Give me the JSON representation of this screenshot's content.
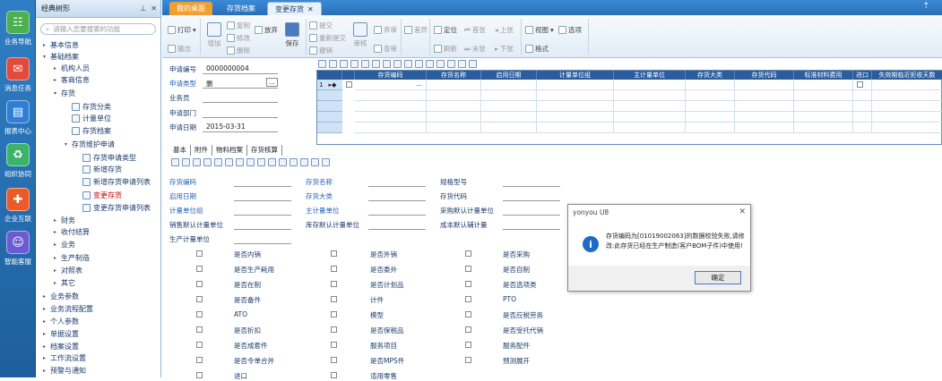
{
  "sidebar": {
    "items": [
      {
        "label": "业务导航"
      },
      {
        "label": "消息任务"
      },
      {
        "label": "报表中心"
      },
      {
        "label": "组织协同"
      },
      {
        "label": "企业互联"
      },
      {
        "label": "智能客服"
      }
    ]
  },
  "nav": {
    "title": "经典树形",
    "search_placeholder": "请输入您要搜索的功能",
    "items": [
      {
        "label": "基本信息",
        "arrow": "▸"
      },
      {
        "label": "基础档案",
        "arrow": "▾"
      },
      {
        "label": "机构人员",
        "arrow": "▸"
      },
      {
        "label": "客商信息",
        "arrow": "▸"
      },
      {
        "label": "存货",
        "arrow": "▾"
      },
      {
        "label": "存货分类"
      },
      {
        "label": "计量单位"
      },
      {
        "label": "存货档案"
      },
      {
        "label": "存货维护申请",
        "arrow": "▾"
      },
      {
        "label": "存货申请类型"
      },
      {
        "label": "新增存货"
      },
      {
        "label": "新增存货申请列表"
      },
      {
        "label": "变更存货"
      },
      {
        "label": "变更存货申请列表"
      },
      {
        "label": "财务",
        "arrow": "▸"
      },
      {
        "label": "收付结算",
        "arrow": "▸"
      },
      {
        "label": "业务",
        "arrow": "▸"
      },
      {
        "label": "生产制造",
        "arrow": "▸"
      },
      {
        "label": "对照表",
        "arrow": "▸"
      },
      {
        "label": "其它",
        "arrow": "▸"
      },
      {
        "label": "业务参数",
        "arrow": "▸"
      },
      {
        "label": "业务流程配置",
        "arrow": "▸"
      },
      {
        "label": "个人参数",
        "arrow": "▸"
      },
      {
        "label": "单据设置",
        "arrow": "▸"
      },
      {
        "label": "档案设置",
        "arrow": "▸"
      },
      {
        "label": "工作流设置",
        "arrow": "▸"
      },
      {
        "label": "预警与通知",
        "arrow": "▸"
      }
    ]
  },
  "tabs": [
    {
      "label": "我的桌面"
    },
    {
      "label": "存货档案"
    },
    {
      "label": "变更存货"
    }
  ],
  "toolbar": {
    "print": "打印",
    "output": "输出",
    "add": "增加",
    "copy": "复制",
    "modify": "修改",
    "delete": "删除",
    "abandon": "放弃",
    "save": "保存",
    "submit": "提交",
    "resubmit": "重新提交",
    "revoke": "撤销",
    "approve": "审核",
    "reject": "弃审",
    "check": "查审",
    "diff": "差异",
    "locate": "定位",
    "refresh": "刷新",
    "first": "首张",
    "prev": "上张",
    "last": "末张",
    "next": "下张",
    "view": "视图",
    "format": "格式",
    "options": "选项"
  },
  "header": {
    "no_label": "申请编号",
    "no_value": "0000000004",
    "type_label": "申请类型",
    "type_value": "删",
    "person_label": "业务员",
    "dept_label": "申请部门",
    "date_label": "申请日期",
    "date_value": "2015-03-31"
  },
  "grid": {
    "columns": [
      "存货编码",
      "存货名称",
      "启用日期",
      "计量单位组",
      "主计量单位",
      "存货大类",
      "存货代码",
      "标准材料费用",
      "进口",
      "失效期临近拒收天数"
    ],
    "row_no": "1"
  },
  "subtabs": [
    "基本",
    "附件",
    "物料档案",
    "存货核算"
  ],
  "fields": {
    "c1": [
      "存货编码",
      "启用日期",
      "计量单位组",
      "销售默认计量单位",
      "生产计量单位"
    ],
    "c2": [
      "存货名称",
      "存货大类",
      "主计量单位",
      "库存默认计量单位"
    ],
    "c3": [
      "规格型号",
      "存货代码",
      "采购默认计量单位",
      "成本默认辅计量"
    ]
  },
  "checks": {
    "c1": [
      "是否内销",
      "是否生产耗用",
      "是否在制",
      "是否备件",
      "ATO",
      "是否折扣",
      "是否成套件",
      "是否令单合并",
      "进口"
    ],
    "c2": [
      "是否外销",
      "是否委外",
      "是否计划品",
      "计件",
      "模型",
      "是否保税品",
      "服务项目",
      "是否MPS件",
      "适用零售"
    ],
    "c3": [
      "是否采购",
      "是否自制",
      "是否选项类",
      "PTO",
      "是否应税劳务",
      "是否受托代销",
      "服务配件",
      "预测展开"
    ]
  },
  "dialog": {
    "title": "yonyou U8",
    "message": "存货编码为[01019002063]的数据校验失败,请修改:此存货已经在生产制造(客户BOM子件)中使用!",
    "ok": "确定"
  }
}
